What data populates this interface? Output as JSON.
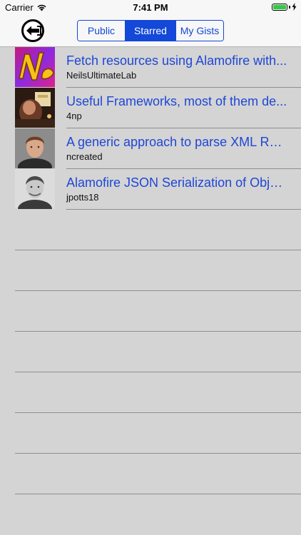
{
  "status_bar": {
    "carrier": "Carrier",
    "time": "7:41 PM",
    "battery_level": 1.0
  },
  "nav": {
    "back_icon": "logout-arrow-icon",
    "segments": [
      "Public",
      "Starred",
      "My Gists"
    ],
    "selected_segment": "Starred"
  },
  "gists": [
    {
      "title": "Fetch resources using Alamofire with...",
      "owner": "NeilsUltimateLab",
      "avatar_icon": "colorful-logo-avatar"
    },
    {
      "title": "Useful Frameworks, most of them de...",
      "owner": "4np",
      "avatar_icon": "photo-avatar"
    },
    {
      "title": "A generic approach to parse XML RE...",
      "owner": "ncreated",
      "avatar_icon": "person-avatar"
    },
    {
      "title": "Alamofire JSON Serialization  of Obje...",
      "owner": "jpotts18",
      "avatar_icon": "person-avatar"
    }
  ],
  "colors": {
    "accent": "#1348d8",
    "title": "#1e47d6",
    "background": "#d4d4d4",
    "battery": "#2ecc40"
  }
}
